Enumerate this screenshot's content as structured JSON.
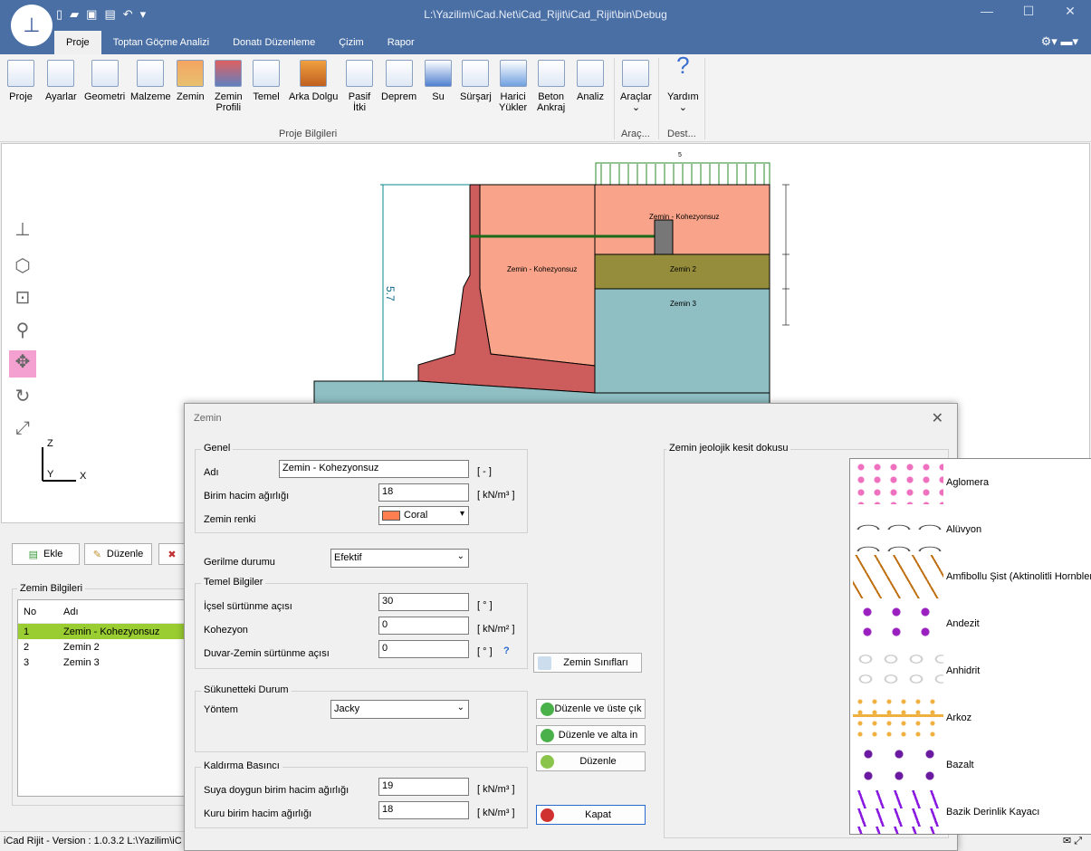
{
  "window": {
    "title": "L:\\Yazilim\\iCad.Net\\iCad_Rijit\\iCad_Rijit\\bin\\Debug"
  },
  "tabs": [
    "Proje",
    "Toptan Göçme Analizi",
    "Donatı Düzenleme",
    "Çizim",
    "Rapor"
  ],
  "ribbon": {
    "buttons": [
      {
        "label": "Proje"
      },
      {
        "label": "Ayarlar"
      },
      {
        "label": "Geometri"
      },
      {
        "label": "Malzeme"
      },
      {
        "label": "Zemin"
      },
      {
        "label": "Zemin\nProfili"
      },
      {
        "label": "Temel"
      },
      {
        "label": "Arka Dolgu"
      },
      {
        "label": "Pasif\nİtki"
      },
      {
        "label": "Deprem"
      },
      {
        "label": "Su"
      },
      {
        "label": "Sürşarj"
      },
      {
        "label": "Harici\nYükler"
      },
      {
        "label": "Beton\nAnkraj"
      },
      {
        "label": "Analiz"
      },
      {
        "label": "Araçlar"
      },
      {
        "label": "Yardım"
      }
    ],
    "groups": [
      "Proje Bilgileri",
      "Araç...",
      "Dest..."
    ]
  },
  "drawing": {
    "surcharge": "5",
    "height_dim": "5.7",
    "soil1": "Zemin - Kohezyonsuz",
    "soil1b": "Zemin - Kohezyonsuz",
    "soil2": "Zemin 2",
    "soil3": "Zemin 3",
    "axis_z": "Z",
    "axis_y": "Y",
    "axis_x": "X"
  },
  "panel": {
    "add": "Ekle",
    "edit": "Düzenle",
    "group": "Zemin Bilgileri",
    "columns": [
      "No",
      "Adı"
    ],
    "rows": [
      {
        "no": "1",
        "name": "Zemin - Kohezyonsuz"
      },
      {
        "no": "2",
        "name": "Zemin 2"
      },
      {
        "no": "3",
        "name": "Zemin 3"
      }
    ]
  },
  "status": {
    "text": "iCad Rijit - Version : 1.0.3.2  L:\\Yazilim\\iC"
  },
  "dialog": {
    "title": "Zemin",
    "genel": "Genel",
    "name_label": "Adı",
    "name_value": "Zemin - Kohezyonsuz",
    "name_unit": "[ - ]",
    "unit_weight_label": "Birim hacim ağırlığı",
    "unit_weight_value": "18",
    "unit_weight_unit": "[ kN/m³ ]",
    "color_label": "Zemin renki",
    "color_value": "Coral",
    "color_hex": "#ff7f50",
    "stress_label": "Gerilme durumu",
    "stress_value": "Efektif",
    "temel": "Temel Bilgiler",
    "friction_label": "İçsel sürtünme açısı",
    "friction_value": "30",
    "friction_unit": "[ ° ]",
    "cohesion_label": "Kohezyon",
    "cohesion_value": "0",
    "cohesion_unit": "[ kN/m² ]",
    "wall_friction_label": "Duvar-Zemin sürtünme açısı",
    "wall_friction_value": "0",
    "wall_friction_unit": "[ ° ]",
    "help": "?",
    "rest": "Sükunetteki Durum",
    "method_label": "Yöntem",
    "method_value": "Jacky",
    "uplift": "Kaldırma Basıncı",
    "sat_label": "Suya doygun birim hacim ağırlığı",
    "sat_value": "19",
    "sat_unit": "[ kN/m³ ]",
    "dry_label": "Kuru birim hacim ağırlığı",
    "dry_value": "18",
    "dry_unit": "[ kN/m³ ]",
    "classes_btn": "Zemin Sınıfları",
    "edit_up_btn": "Düzenle ve üste çık",
    "edit_down_btn": "Düzenle ve alta in",
    "edit_btn": "Düzenle",
    "close_btn": "Kapat",
    "texture_title": "Zemin jeolojik kesit dokusu",
    "textures": [
      "Aglomera",
      "Alüvyon",
      "Amfibollu Şist (Aktinolitli Hornblend, G",
      "Andezit",
      "Anhidrit",
      "Arkoz",
      "Bazalt",
      "Bazik Derinlik Kayacı"
    ]
  }
}
